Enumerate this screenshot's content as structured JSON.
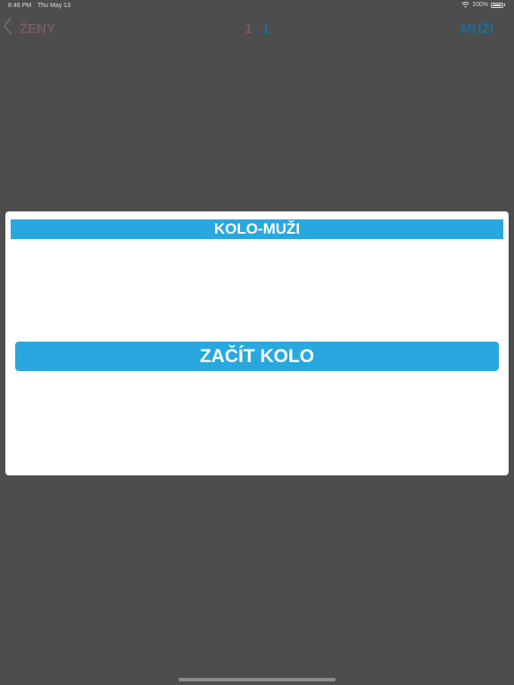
{
  "status_bar": {
    "time": "8:46 PM",
    "date": "Thu May 13",
    "battery": "100%",
    "icons": [
      "wifi-icon",
      "battery-icon"
    ]
  },
  "navbar": {
    "back_icon": "chevron-left-icon",
    "left_team": "ŽENY",
    "score_left": "1",
    "score_separator": ":",
    "score_right": "1",
    "right_team": "MUŽI"
  },
  "modal": {
    "title": "KOLO-MUŽI",
    "start_button_label": "ZAČÍT KOLO"
  },
  "colors": {
    "accent": "#29a8e0",
    "overlay": "#4d4d4d",
    "women_team": "#7a5a64",
    "men_team": "#1f6f94"
  }
}
